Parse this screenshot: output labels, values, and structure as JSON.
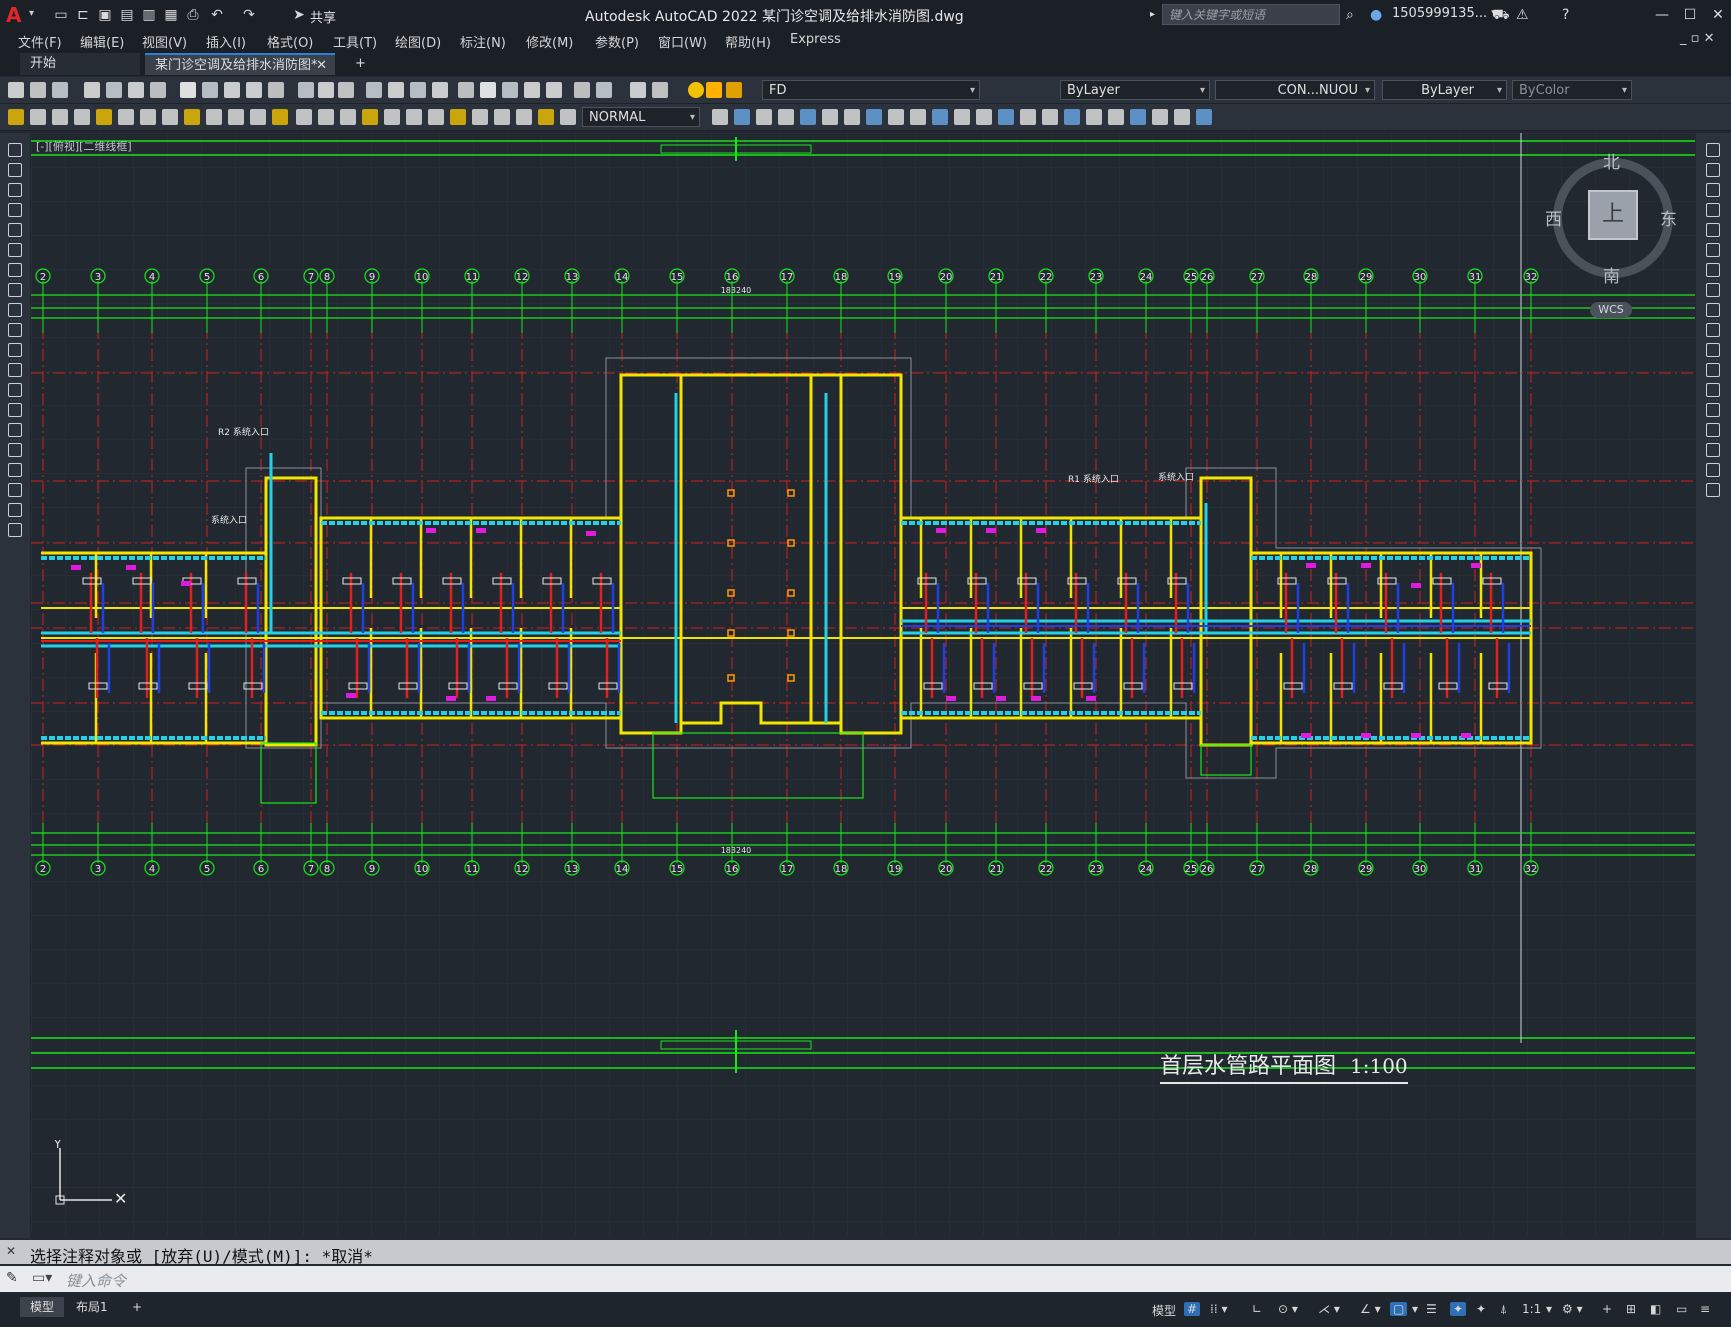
{
  "titlebar": {
    "title": "Autodesk AutoCAD 2022    某门诊空调及给排水消防图.dwg",
    "share_label": "共享",
    "search_placeholder": "键入关键字或短语",
    "user": "1505999135... ▾"
  },
  "menubar": [
    "文件(F)",
    "编辑(E)",
    "视图(V)",
    "插入(I)",
    "格式(O)",
    "工具(T)",
    "绘图(D)",
    "标注(N)",
    "修改(M)",
    "参数(P)",
    "窗口(W)",
    "帮助(H)",
    "Express"
  ],
  "tabs": {
    "start": "开始",
    "document": "某门诊空调及给排水消防图*"
  },
  "properties": {
    "layer": "FD",
    "color": "ByLayer",
    "linetype": "CON...NUOU",
    "lineweight": "ByLayer",
    "plotstyle": "ByColor",
    "dimstyle": "NORMAL"
  },
  "viewport_label": "[-][俯视][二维线框]",
  "viewcube": {
    "north": "北",
    "south": "南",
    "east": "东",
    "west": "西",
    "top": "上",
    "wcs": "WCS"
  },
  "drawing": {
    "title": "首层水管路平面图",
    "scale": "1:100",
    "axis_numbers": [
      "2",
      "3",
      "4",
      "5",
      "6",
      "7",
      "8",
      "9",
      "10",
      "11",
      "12",
      "13",
      "14",
      "15",
      "16",
      "17",
      "18",
      "19",
      "20",
      "21",
      "22",
      "23",
      "24",
      "25",
      "26",
      "27",
      "28",
      "29",
      "30",
      "31",
      "32"
    ],
    "total_dim": "183240",
    "labels": {
      "r2": "R2 系统入口",
      "r1": "R1 系统入口",
      "sys_entry": "系统入口"
    }
  },
  "command": {
    "history": "选择注释对象或 [放弃(U)/模式(M)]: *取消*",
    "placeholder": "键入命令"
  },
  "status": {
    "layouts": [
      "模型",
      "布局1"
    ],
    "model_label": "模型",
    "scale": "1:1"
  },
  "colors": {
    "background": "#212830",
    "grid": "#2a323c",
    "axis_red": "#d01f1f",
    "wall_yellow": "#f2e600",
    "pipe_cyan": "#25d0e6",
    "dim_green": "#19e619",
    "magenta": "#e01be0",
    "blue": "#1f3fe0"
  }
}
